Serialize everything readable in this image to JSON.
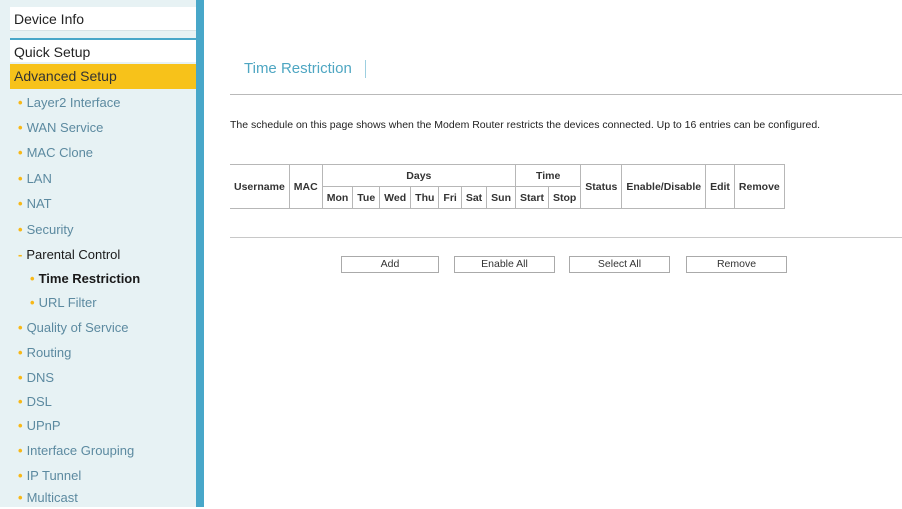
{
  "sidebar": {
    "device_info": "Device Info",
    "quick_setup": "Quick Setup",
    "advanced_setup": "Advanced Setup",
    "items": [
      {
        "label": "Layer2 Interface"
      },
      {
        "label": "WAN Service"
      },
      {
        "label": "MAC Clone"
      },
      {
        "label": "LAN"
      },
      {
        "label": "NAT"
      },
      {
        "label": "Security"
      },
      {
        "label": "Parental Control"
      },
      {
        "label": "Time Restriction"
      },
      {
        "label": "URL Filter"
      },
      {
        "label": "Quality of Service"
      },
      {
        "label": "Routing"
      },
      {
        "label": "DNS"
      },
      {
        "label": "DSL"
      },
      {
        "label": "UPnP"
      },
      {
        "label": "Interface Grouping"
      },
      {
        "label": "IP Tunnel"
      },
      {
        "label": "Multicast"
      }
    ]
  },
  "page": {
    "title": "Time Restriction",
    "description": "The schedule on this page shows when the Modem Router restricts the devices connected. Up to 16 entries can be configured."
  },
  "table": {
    "username": "Username",
    "mac": "MAC",
    "days": "Days",
    "time": "Time",
    "status": "Status",
    "enable_disable": "Enable/Disable",
    "edit": "Edit",
    "remove": "Remove",
    "day_names": [
      "Mon",
      "Tue",
      "Wed",
      "Thu",
      "Fri",
      "Sat",
      "Sun"
    ],
    "start": "Start",
    "stop": "Stop"
  },
  "buttons": {
    "add": "Add",
    "enable_all": "Enable All",
    "select_all": "Select All",
    "remove": "Remove"
  },
  "colors": {
    "accent": "#48a7c9",
    "highlight": "#f7c21a",
    "title": "#4ea6c2"
  }
}
